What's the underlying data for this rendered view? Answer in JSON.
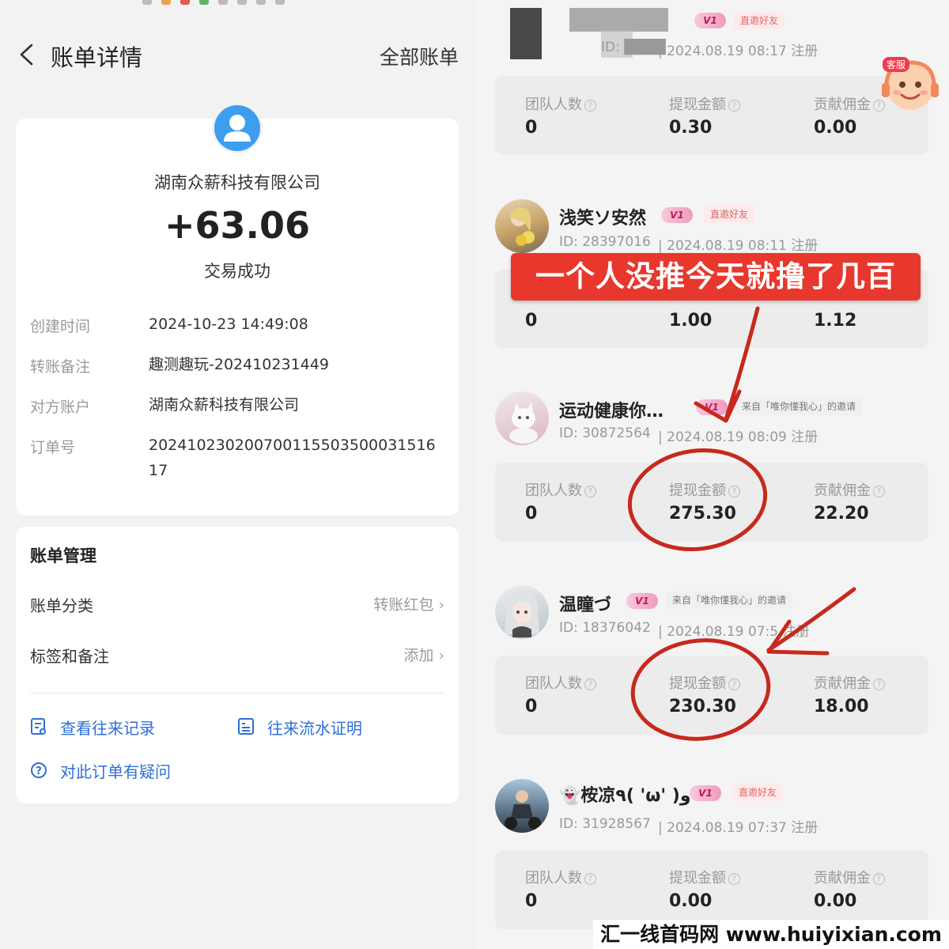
{
  "left": {
    "nav": {
      "back_icon": "chevron-left-icon",
      "title": "账单详情",
      "all_bills": "全部账单"
    },
    "payee": {
      "avatar_icon": "user-icon",
      "name": "湖南众薪科技有限公司",
      "amount": "+63.06",
      "status": "交易成功"
    },
    "details": [
      {
        "label": "创建时间",
        "value": "2024-10-23 14:49:08"
      },
      {
        "label": "转账备注",
        "value": "趣测趣玩-202410231449"
      },
      {
        "label": "对方账户",
        "value": "湖南众薪科技有限公司"
      },
      {
        "label": "订单号",
        "value": "20241023020070011550350003151617"
      }
    ],
    "management": {
      "title": "账单管理",
      "category_label": "账单分类",
      "category_value": "转账红包",
      "tags_label": "标签和备注",
      "tags_value": "添加",
      "history": "查看往来记录",
      "proof": "往来流水证明",
      "question": "对此订单有疑问"
    }
  },
  "right": {
    "top_partial": {
      "id": "ID: ████",
      "date": "2024.08.19 08:17",
      "register": "注册",
      "badge": "V1",
      "source": "直邀好友"
    },
    "stat_headers": {
      "team": "团队人数",
      "withdraw": "提现金额",
      "commission": "贡献佣金"
    },
    "records": [
      {
        "name": "",
        "team": "0",
        "withdraw": "0.30",
        "commission": "0.00"
      },
      {
        "name": "浅笑ソ安然",
        "badge": "V1",
        "source": "直邀好友",
        "id": "ID:  28397016",
        "date": "2024.08.19 08:11",
        "register": "注册",
        "team": "0",
        "withdraw": "1.00",
        "commission": "1.12"
      },
      {
        "name": "运动健康你…",
        "badge": "V1",
        "source": "来自「唯你懂我心」的邀请",
        "id": "ID:  30872564",
        "date": "2024.08.19 08:09",
        "register": "注册",
        "team": "0",
        "withdraw": "275.30",
        "commission": "22.20"
      },
      {
        "name": "温瞳づ",
        "badge": "V1",
        "source": "来自「唯你懂我心」的邀请",
        "id": "ID:  18376042",
        "date": "2024.08.19 07:5",
        "register": "注册",
        "team": "0",
        "withdraw": "230.30",
        "commission": "18.00"
      },
      {
        "name": "👻桉凉٩( 'ω' )و",
        "badge": "V1",
        "source": "直邀好友",
        "id": "ID:  31928567",
        "date": "2024.08.19 07:37",
        "register": "注册",
        "team": "0",
        "withdraw": "0.00",
        "commission": "0.00"
      }
    ],
    "banner": "一个人没推今天就撸了几百",
    "customer_service": "客服",
    "watermark": "汇一线首码网 www.huiyixian.com",
    "colors": {
      "annotation": "#c8281e",
      "banner": "#e8372d",
      "link": "#2f6fd6"
    }
  }
}
